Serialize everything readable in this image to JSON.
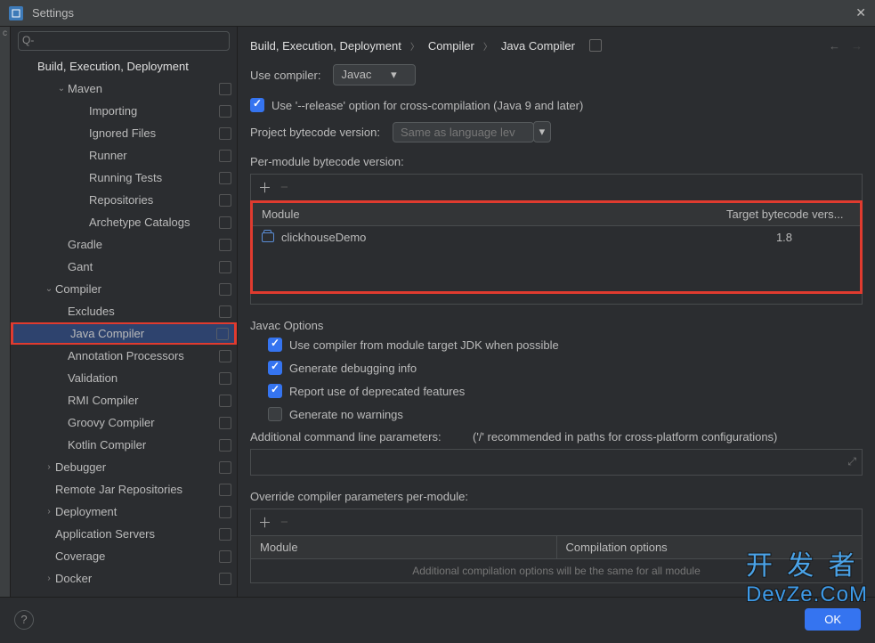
{
  "window": {
    "title": "Settings"
  },
  "sidebar": {
    "search_placeholder": "",
    "header": "Build, Execution, Deployment",
    "items": [
      {
        "label": "Maven",
        "level": 1,
        "chev": "v"
      },
      {
        "label": "Importing",
        "level": 2
      },
      {
        "label": "Ignored Files",
        "level": 2
      },
      {
        "label": "Runner",
        "level": 2
      },
      {
        "label": "Running Tests",
        "level": 2
      },
      {
        "label": "Repositories",
        "level": 2
      },
      {
        "label": "Archetype Catalogs",
        "level": 2
      },
      {
        "label": "Gradle",
        "level": 1
      },
      {
        "label": "Gant",
        "level": 1
      },
      {
        "label": "Compiler",
        "level": 0,
        "chev": "v"
      },
      {
        "label": "Excludes",
        "level": 1
      },
      {
        "label": "Java Compiler",
        "level": 1,
        "selected": true
      },
      {
        "label": "Annotation Processors",
        "level": 1
      },
      {
        "label": "Validation",
        "level": 1
      },
      {
        "label": "RMI Compiler",
        "level": 1
      },
      {
        "label": "Groovy Compiler",
        "level": 1
      },
      {
        "label": "Kotlin Compiler",
        "level": 1
      },
      {
        "label": "Debugger",
        "level": 0,
        "chev": ">"
      },
      {
        "label": "Remote Jar Repositories",
        "level": 0
      },
      {
        "label": "Deployment",
        "level": 0,
        "chev": ">"
      },
      {
        "label": "Application Servers",
        "level": 0
      },
      {
        "label": "Coverage",
        "level": 0
      },
      {
        "label": "Docker",
        "level": 0,
        "chev": ">"
      }
    ]
  },
  "breadcrumbs": [
    "Build, Execution, Deployment",
    "Compiler",
    "Java Compiler"
  ],
  "main": {
    "use_compiler_label": "Use compiler:",
    "use_compiler_value": "Javac",
    "release_option": "Use '--release' option for cross-compilation (Java 9 and later)",
    "project_bytecode_label": "Project bytecode version:",
    "project_bytecode_placeholder": "Same as language lev",
    "per_module_label": "Per-module bytecode version:",
    "table1": {
      "headers": [
        "Module",
        "Target bytecode vers..."
      ],
      "rows": [
        {
          "module": "clickhouseDemo",
          "target": "1.8"
        }
      ]
    },
    "javac_section": "Javac Options",
    "opt_target_jdk": "Use compiler from module target JDK when possible",
    "opt_debug": "Generate debugging info",
    "opt_deprecated": "Report use of deprecated features",
    "opt_nowarn": "Generate no warnings",
    "addl_params_label": "Additional command line parameters:",
    "addl_params_hint": "('/' recommended in paths for cross-platform configurations)",
    "override_label": "Override compiler parameters per-module:",
    "table2": {
      "headers": [
        "Module",
        "Compilation options"
      ]
    },
    "table2_hint": "Additional compilation options will be the same for all module"
  },
  "footer": {
    "ok": "OK"
  },
  "watermark": {
    "zh": "开 发 者",
    "en": "DevZe.CoM"
  }
}
